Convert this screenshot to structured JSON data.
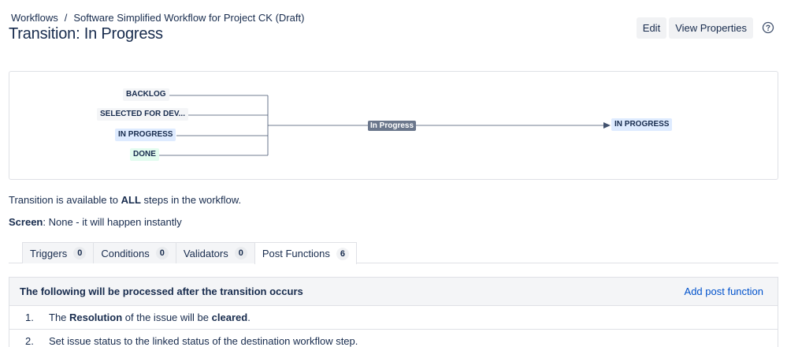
{
  "breadcrumb": {
    "root": "Workflows",
    "separator": "/",
    "current": "Software Simplified Workflow for Project CK (Draft)"
  },
  "page_title": "Transition: In Progress",
  "actions": {
    "edit_label": "Edit",
    "view_properties_label": "View Properties",
    "help_icon": "question-circle-icon"
  },
  "diagram": {
    "source_steps": [
      {
        "label": "BACKLOG",
        "color": "#f4f5f7"
      },
      {
        "label": "SELECTED FOR DEV...",
        "color": "#f4f5f7"
      },
      {
        "label": "IN PROGRESS",
        "color": "#deebff"
      },
      {
        "label": "DONE",
        "color": "#e3fcef"
      }
    ],
    "transition_label": "In Progress",
    "destination_step": {
      "label": "IN PROGRESS",
      "color": "#deebff"
    }
  },
  "availability": {
    "prefix": "Transition is available to",
    "emphasis": "ALL",
    "suffix": "steps in the workflow."
  },
  "screen": {
    "label": "Screen",
    "value": ": None - it will happen instantly"
  },
  "tabs": [
    {
      "label": "Triggers",
      "count": "0",
      "active": false
    },
    {
      "label": "Conditions",
      "count": "0",
      "active": false
    },
    {
      "label": "Validators",
      "count": "0",
      "active": false
    },
    {
      "label": "Post Functions",
      "count": "6",
      "active": true
    }
  ],
  "post_functions": {
    "header": "The following will be processed after the transition occurs",
    "add_label": "Add post function",
    "items": [
      {
        "number": "1.",
        "text_1": "The ",
        "bold_1": "Resolution",
        "text_2": " of the issue will be ",
        "bold_2": "cleared",
        "text_3": "."
      },
      {
        "number": "2.",
        "text": "Set issue status to the linked status of the destination workflow step."
      }
    ]
  },
  "colors": {
    "link": "#0052cc",
    "text": "#172b4d",
    "border": "#dfe1e6",
    "transition_label_bg": "#6b778c"
  }
}
